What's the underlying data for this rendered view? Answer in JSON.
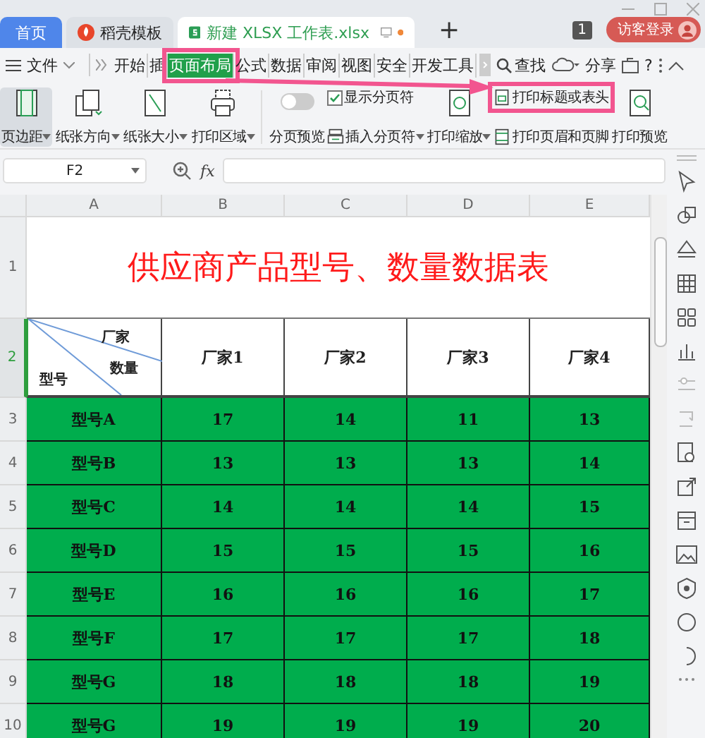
{
  "tabs": [
    {
      "label": "首页",
      "selected": false,
      "kind": "home"
    },
    {
      "label": "稻壳模板",
      "selected": false,
      "kind": "template"
    },
    {
      "label": "新建 XLSX 工作表.xlsx",
      "selected": true,
      "kind": "document",
      "unsaved": true
    }
  ],
  "add_tab": "+",
  "badge": "1",
  "login": "访客登录",
  "menu": {
    "file": "文件",
    "items": [
      {
        "label": "开始",
        "selected": false,
        "highlighted": false
      },
      {
        "label": "插",
        "selected": false,
        "highlighted": false
      },
      {
        "label": "页面布局",
        "selected": true,
        "highlighted": true
      },
      {
        "label": "公式",
        "selected": false,
        "highlighted": false
      },
      {
        "label": "数据",
        "selected": false,
        "highlighted": false
      },
      {
        "label": "审阅",
        "selected": false,
        "highlighted": false
      },
      {
        "label": "视图",
        "selected": false,
        "highlighted": false
      },
      {
        "label": "安全",
        "selected": false,
        "highlighted": false
      },
      {
        "label": "开发工具",
        "selected": false,
        "highlighted": false
      }
    ],
    "search": "查找",
    "share": "分享",
    "help": "?"
  },
  "ribbon": {
    "groups": [
      {
        "items": [
          {
            "kind": "big",
            "label": "页边距",
            "dropdown": true,
            "selected": true
          },
          {
            "kind": "big",
            "label": "纸张方向",
            "dropdown": true,
            "selected": false
          },
          {
            "kind": "big",
            "label": "纸张大小",
            "dropdown": true,
            "selected": false
          },
          {
            "kind": "big",
            "label": "打印区域",
            "dropdown": true,
            "selected": false
          }
        ]
      },
      {
        "items": [
          {
            "kind": "toggle",
            "label": "分页预览",
            "on": false
          },
          {
            "kind": "pair",
            "top": {
              "kind": "check",
              "label": "显示分页符",
              "checked": true
            },
            "bottom": {
              "kind": "small",
              "label": "插入分页符",
              "dropdown": true
            }
          },
          {
            "kind": "big",
            "label": "打印缩放",
            "dropdown": true,
            "selected": false
          },
          {
            "kind": "pair",
            "top": {
              "kind": "small",
              "label": "打印标题或表头",
              "dropdown": false,
              "highlighted": true
            },
            "bottom": {
              "kind": "small",
              "label": "打印页眉和页脚",
              "dropdown": false
            }
          },
          {
            "kind": "big",
            "label": "打印预览",
            "dropdown": false,
            "selected": false
          }
        ]
      }
    ]
  },
  "arrow": true,
  "formula_bar": {
    "name_box": "F2",
    "function_label": "fx"
  },
  "sheet": {
    "columns": [
      "A",
      "B",
      "C",
      "D",
      "E"
    ],
    "title_row": {
      "number": "1",
      "selected": false,
      "title": "供应商产品型号、数量数据表"
    },
    "header_row": {
      "number": "2",
      "selected": true,
      "corner_top": "厂家",
      "corner_middle": "数量",
      "corner_bottom": "型号",
      "cells": [
        "厂家1",
        "厂家2",
        "厂家3",
        "厂家4"
      ]
    },
    "rows": [
      {
        "number": "3",
        "selected": false,
        "cells": [
          "型号A",
          "17",
          "14",
          "11",
          "13"
        ]
      },
      {
        "number": "4",
        "selected": false,
        "cells": [
          "型号B",
          "13",
          "13",
          "13",
          "14"
        ]
      },
      {
        "number": "5",
        "selected": false,
        "cells": [
          "型号C",
          "14",
          "14",
          "14",
          "15"
        ]
      },
      {
        "number": "6",
        "selected": false,
        "cells": [
          "型号D",
          "15",
          "15",
          "15",
          "16"
        ]
      },
      {
        "number": "7",
        "selected": false,
        "cells": [
          "型号E",
          "16",
          "16",
          "16",
          "17"
        ]
      },
      {
        "number": "8",
        "selected": false,
        "cells": [
          "型号F",
          "17",
          "17",
          "17",
          "18"
        ]
      },
      {
        "number": "9",
        "selected": false,
        "cells": [
          "型号G",
          "18",
          "18",
          "18",
          "19"
        ]
      },
      {
        "number": "10",
        "selected": false,
        "cells": [
          "型号G",
          "19",
          "19",
          "19",
          "20"
        ]
      }
    ]
  }
}
